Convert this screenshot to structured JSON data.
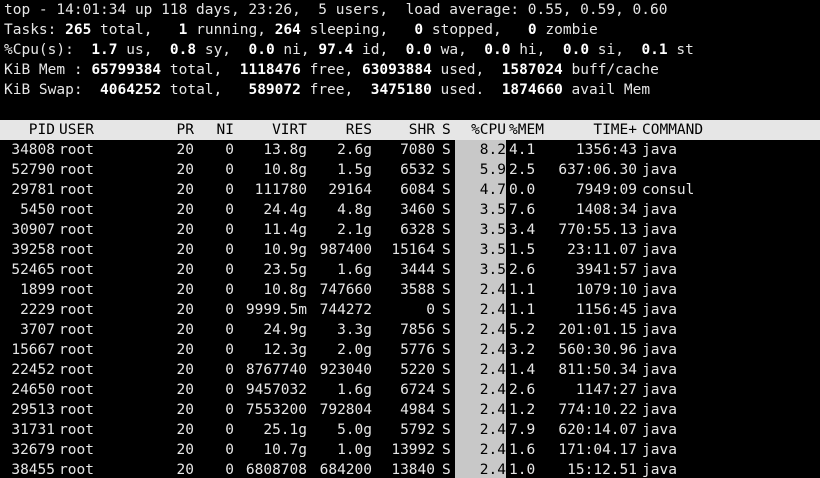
{
  "summary": {
    "line1": "top - 14:01:34 up 118 days, 23:26,  5 users,  load average: 0.55, 0.59, 0.60",
    "tasks": {
      "label": "Tasks:",
      "total": "265",
      "total_lbl": " total,",
      "running": "1",
      "running_lbl": " running,",
      "sleeping": "264",
      "sleeping_lbl": " sleeping,",
      "stopped": "0",
      "stopped_lbl": " stopped,",
      "zombie": "0",
      "zombie_lbl": " zombie"
    },
    "cpu": {
      "label": "%Cpu(s):",
      "us": "1.7",
      "us_lbl": " us,",
      "sy": "0.8",
      "sy_lbl": " sy,",
      "ni": "0.0",
      "ni_lbl": " ni,",
      "id": "97.4",
      "id_lbl": " id,",
      "wa": "0.0",
      "wa_lbl": " wa,",
      "hi": "0.0",
      "hi_lbl": " hi,",
      "si": "0.0",
      "si_lbl": " si,",
      "st": "0.1",
      "st_lbl": " st"
    },
    "mem": {
      "label": "KiB Mem :",
      "total": "65799384",
      "total_lbl": " total,",
      "free": "1118476",
      "free_lbl": " free,",
      "used": "63093884",
      "used_lbl": " used,",
      "buff": "1587024",
      "buff_lbl": " buff/cache"
    },
    "swap": {
      "label": "KiB Swap:",
      "total": "4064252",
      "total_lbl": " total,",
      "free": "589072",
      "free_lbl": " free,",
      "used": "3475180",
      "used_lbl": " used.",
      "avail": "1874660",
      "avail_lbl": " avail Mem"
    }
  },
  "table": {
    "columns": [
      "PID",
      "USER",
      "PR",
      "NI",
      "VIRT",
      "RES",
      "SHR",
      "S",
      "%CPU",
      "%MEM",
      "TIME+",
      "COMMAND"
    ],
    "rows": [
      [
        "34808",
        "root",
        "20",
        "0",
        "13.8g",
        "2.6g",
        "7080",
        "S",
        "8.2",
        "4.1",
        "1356:43",
        "java"
      ],
      [
        "52790",
        "root",
        "20",
        "0",
        "10.8g",
        "1.5g",
        "6532",
        "S",
        "5.9",
        "2.5",
        "637:06.30",
        "java"
      ],
      [
        "29781",
        "root",
        "20",
        "0",
        "111780",
        "29164",
        "6084",
        "S",
        "4.7",
        "0.0",
        "7949:09",
        "consul"
      ],
      [
        "5450",
        "root",
        "20",
        "0",
        "24.4g",
        "4.8g",
        "3460",
        "S",
        "3.5",
        "7.6",
        "1408:34",
        "java"
      ],
      [
        "30907",
        "root",
        "20",
        "0",
        "11.4g",
        "2.1g",
        "6328",
        "S",
        "3.5",
        "3.4",
        "770:55.13",
        "java"
      ],
      [
        "39258",
        "root",
        "20",
        "0",
        "10.9g",
        "987400",
        "15164",
        "S",
        "3.5",
        "1.5",
        "23:11.07",
        "java"
      ],
      [
        "52465",
        "root",
        "20",
        "0",
        "23.5g",
        "1.6g",
        "3444",
        "S",
        "3.5",
        "2.6",
        "3941:57",
        "java"
      ],
      [
        "1899",
        "root",
        "20",
        "0",
        "10.8g",
        "747660",
        "3588",
        "S",
        "2.4",
        "1.1",
        "1079:10",
        "java"
      ],
      [
        "2229",
        "root",
        "20",
        "0",
        "9999.5m",
        "744272",
        "0",
        "S",
        "2.4",
        "1.1",
        "1156:45",
        "java"
      ],
      [
        "3707",
        "root",
        "20",
        "0",
        "24.9g",
        "3.3g",
        "7856",
        "S",
        "2.4",
        "5.2",
        "201:01.15",
        "java"
      ],
      [
        "15667",
        "root",
        "20",
        "0",
        "12.3g",
        "2.0g",
        "5776",
        "S",
        "2.4",
        "3.2",
        "560:30.96",
        "java"
      ],
      [
        "22452",
        "root",
        "20",
        "0",
        "8767740",
        "923040",
        "5220",
        "S",
        "2.4",
        "1.4",
        "811:50.34",
        "java"
      ],
      [
        "24650",
        "root",
        "20",
        "0",
        "9457032",
        "1.6g",
        "6724",
        "S",
        "2.4",
        "2.6",
        "1147:27",
        "java"
      ],
      [
        "29513",
        "root",
        "20",
        "0",
        "7553200",
        "792804",
        "4984",
        "S",
        "2.4",
        "1.2",
        "774:10.22",
        "java"
      ],
      [
        "31731",
        "root",
        "20",
        "0",
        "25.1g",
        "5.0g",
        "5792",
        "S",
        "2.4",
        "7.9",
        "620:14.07",
        "java"
      ],
      [
        "32679",
        "root",
        "20",
        "0",
        "10.7g",
        "1.0g",
        "13992",
        "S",
        "2.4",
        "1.6",
        "171:04.17",
        "java"
      ],
      [
        "38455",
        "root",
        "20",
        "0",
        "6808708",
        "684200",
        "13840",
        "S",
        "2.4",
        "1.0",
        "15:12.51",
        "java"
      ]
    ]
  }
}
